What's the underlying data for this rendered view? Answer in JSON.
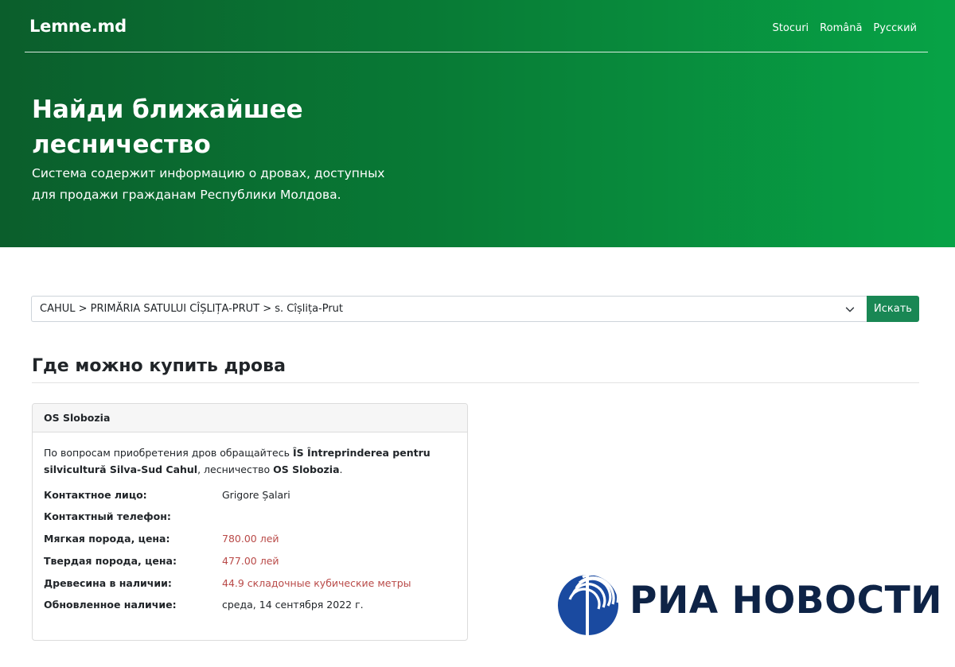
{
  "navbar": {
    "brand": "Lemne.md",
    "links": [
      "Stocuri",
      "Română",
      "Русский"
    ]
  },
  "hero": {
    "title": "Найди ближайшее лесничество",
    "subtitle": "Система содержит информацию о дровах, доступных для продажи гражданам Республики Молдова."
  },
  "search": {
    "selected": "CAHUL > PRIMĂRIA SATULUI CÎȘLIȚA-PRUT > s. Cîșlița-Prut",
    "button_label": "Искать"
  },
  "section": {
    "title": "Где можно купить дрова"
  },
  "card": {
    "header": "OS Slobozia",
    "intro_prefix": "По вопросам приобретения дров обращайтесь",
    "enterprise": "ÎS Întreprinderea pentru silvicultură Silva-Sud Cahul",
    "intro_middle": ", лесничество",
    "forestry": "OS Slobozia",
    "intro_suffix": ".",
    "rows": [
      {
        "label": "Контактное лицо:",
        "value": "Grigore Șalari",
        "highlight": false
      },
      {
        "label": "Контактный телефон:",
        "value": "",
        "highlight": false
      },
      {
        "label": "Мягкая порода, цена:",
        "value": "780.00 лей",
        "highlight": true
      },
      {
        "label": "Твердая порода, цена:",
        "value": "477.00 лей",
        "highlight": true
      },
      {
        "label": "Древесина в наличии:",
        "value": "44.9 складочные кубические метры",
        "highlight": true
      },
      {
        "label": "Обновленное наличие:",
        "value": "среда, 14 сентября 2022 г.",
        "highlight": false
      }
    ]
  },
  "watermark": {
    "text": "РИА НОВОСТИ"
  },
  "colors": {
    "hero_start": "#0b5e2c",
    "hero_end": "#07a346",
    "button": "#198754",
    "highlight_value": "#b94a48",
    "watermark_text": "#0e2346",
    "watermark_logo": "#1a4aa0"
  },
  "icons": {
    "select_chevron": "chevron-down-icon",
    "watermark_logo": "ria-globe-logo"
  }
}
